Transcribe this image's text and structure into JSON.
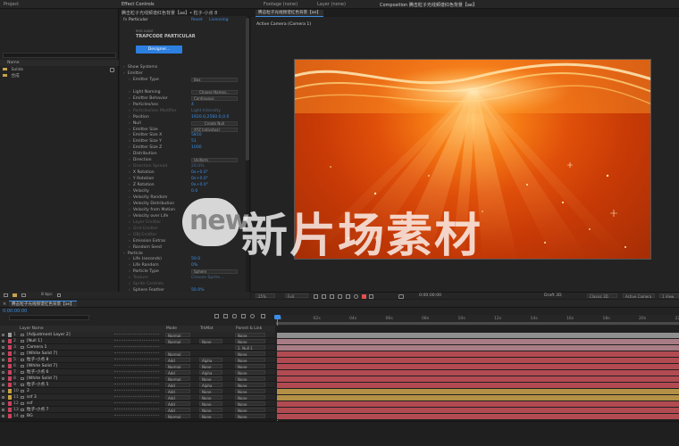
{
  "project_panel": {
    "title": "Project",
    "col_name": "Name",
    "items": [
      {
        "label": "Solids"
      },
      {
        "label": "合成"
      }
    ]
  },
  "effect_controls": {
    "tab": "Effect Controls",
    "layer": "腾击粒子光线频谱红色背景【ae】• 粒子-小点 8",
    "effect_name": "Particular",
    "reset": "Reset",
    "licensing": "Licensing",
    "brand_top": "RED GIANT",
    "brand_main": "TRAPCODE PARTICULAR",
    "designer_button": "Designer...",
    "props": [
      {
        "label": "Show Systems",
        "value": "",
        "indent": 0
      },
      {
        "label": "Emitter",
        "value": "",
        "indent": 0
      },
      {
        "label": "Emitter Type",
        "value": "Box",
        "indent": 1,
        "kind": "drop"
      },
      {
        "label": "",
        "value": "",
        "indent": 1
      },
      {
        "label": "Light Naming",
        "value": "Choose Names...",
        "indent": 1,
        "kind": "btn"
      },
      {
        "label": "Emitter Behavior",
        "value": "Continuous",
        "indent": 1,
        "kind": "drop"
      },
      {
        "label": "Particles/sec",
        "value": "4",
        "indent": 1
      },
      {
        "label": "Particles/sec Modifier",
        "value": "Light Intensity",
        "indent": 1,
        "dim": true
      },
      {
        "label": "Position",
        "value": "1920.0,2560.0,0.0",
        "indent": 1
      },
      {
        "label": "Null",
        "value": "Create Null",
        "indent": 1,
        "kind": "btn"
      },
      {
        "label": "Emitter Size",
        "value": "XYZ Individual",
        "indent": 1,
        "kind": "drop"
      },
      {
        "label": "Emitter Size X",
        "value": "5810",
        "indent": 1
      },
      {
        "label": "Emitter Size Y",
        "value": "51",
        "indent": 1
      },
      {
        "label": "Emitter Size Z",
        "value": "1000",
        "indent": 1
      },
      {
        "label": "Distribution",
        "value": "",
        "indent": 1
      },
      {
        "label": "Direction",
        "value": "Uniform",
        "indent": 1,
        "kind": "drop"
      },
      {
        "label": "Direction Spread",
        "value": "20.0%",
        "indent": 1,
        "dim": true
      },
      {
        "label": "X Rotation",
        "value": "0x+0.0°",
        "indent": 1
      },
      {
        "label": "Y Rotation",
        "value": "0x+0.0°",
        "indent": 1
      },
      {
        "label": "Z Rotation",
        "value": "0x+0.0°",
        "indent": 1
      },
      {
        "label": "Velocity",
        "value": "0.0",
        "indent": 1
      },
      {
        "label": "Velocity Random",
        "value": "",
        "indent": 1
      },
      {
        "label": "Velocity Distribution",
        "value": "",
        "indent": 1
      },
      {
        "label": "Velocity from Motion",
        "value": "",
        "indent": 1
      },
      {
        "label": "Velocity over Life",
        "value": "",
        "indent": 1
      },
      {
        "label": "Layer Emitter",
        "value": "",
        "indent": 1,
        "dim": true
      },
      {
        "label": "Grid Emitter",
        "value": "",
        "indent": 1,
        "dim": true
      },
      {
        "label": "OBJ Emitter",
        "value": "",
        "indent": 1,
        "dim": true
      },
      {
        "label": "Emission Extras",
        "value": "",
        "indent": 1
      },
      {
        "label": "Random Seed",
        "value": "",
        "indent": 1
      },
      {
        "label": "Particle",
        "value": "",
        "indent": 0
      },
      {
        "label": "Life (seconds)",
        "value": "50.0",
        "indent": 1
      },
      {
        "label": "Life Random",
        "value": "0%",
        "indent": 1
      },
      {
        "label": "Particle Type",
        "value": "Sphere",
        "indent": 1,
        "kind": "drop"
      },
      {
        "label": "Texture",
        "value": "Choose Sprite...",
        "indent": 1,
        "dim": true
      },
      {
        "label": "Sprite Controls",
        "value": "",
        "indent": 1,
        "dim": true
      },
      {
        "label": "Sphere Feather",
        "value": "50.0%",
        "indent": 1
      },
      {
        "label": "Particle Physics",
        "value": "",
        "indent": 1
      }
    ]
  },
  "footage_tabs": [
    "Footage (none)",
    "Layer (none)"
  ],
  "comp_panel": {
    "tab": "Composition",
    "comp_name": "腾击粒子光线频谱红色背景【ae】",
    "active_camera": "Active Camera (Camera 1)",
    "sub_tab": "腾击粒子光线频谱红色背景【ae】",
    "zoom": "25%",
    "quality": "Full",
    "timecode": "0:00:00:00",
    "renderer": "Draft 3D",
    "renderer_mode": "Classic 3D",
    "view": "Active Camera",
    "views": "1 View"
  },
  "watermark": {
    "logo": "new",
    "text": "新片场素材"
  },
  "timeline": {
    "tab": "腾击粒子光线频谱红色背景【ae】",
    "timecode": "0:00:00:00",
    "bpc": "8 bpc",
    "headers": {
      "layer_name": "Layer Name",
      "mode": "Mode",
      "trkmat": "TrkMat",
      "parent": "Parent & Link"
    },
    "ruler": [
      "0s",
      "02s",
      "04s",
      "06s",
      "08s",
      "10s",
      "12s",
      "14s",
      "16s",
      "18s",
      "20s",
      "22s"
    ],
    "layers": [
      {
        "num": "1",
        "name": "[Adjustment Layer 2]",
        "mode": "Normal",
        "trkmat": "",
        "parent": "None",
        "color": "#9a9a9a",
        "bar": "#8f8f8f"
      },
      {
        "num": "2",
        "name": "[Null 1]",
        "mode": "Normal",
        "trkmat": "None",
        "parent": "None",
        "color": "#c7435e",
        "bar": "#a87c84"
      },
      {
        "num": "3",
        "name": "Camera 1",
        "mode": "",
        "trkmat": "",
        "parent": "2. Null 1",
        "color": "#c7435e",
        "bar": "#a87c84"
      },
      {
        "num": "4",
        "name": "[White Solid 7]",
        "mode": "Normal",
        "trkmat": "",
        "parent": "None",
        "color": "#c7435e",
        "bar": "#b24a52"
      },
      {
        "num": "5",
        "name": "粒子-小点 8",
        "mode": "Add",
        "trkmat": "Alpha",
        "parent": "None",
        "color": "#c7435e",
        "bar": "#b24a52"
      },
      {
        "num": "6",
        "name": "[White Solid 7]",
        "mode": "Normal",
        "trkmat": "None",
        "parent": "None",
        "color": "#c7435e",
        "bar": "#b24a52"
      },
      {
        "num": "7",
        "name": "粒子-小点 6",
        "mode": "Add",
        "trkmat": "Alpha",
        "parent": "None",
        "color": "#c7435e",
        "bar": "#b24a52"
      },
      {
        "num": "8",
        "name": "[White Solid 7]",
        "mode": "Normal",
        "trkmat": "None",
        "parent": "None",
        "color": "#c7435e",
        "bar": "#b24a52"
      },
      {
        "num": "9",
        "name": "粒子-小点 5",
        "mode": "Add",
        "trkmat": "Alpha",
        "parent": "None",
        "color": "#c7435e",
        "bar": "#b24a52"
      },
      {
        "num": "10",
        "name": "2",
        "mode": "Add",
        "trkmat": "None",
        "parent": "None",
        "color": "#c8a042",
        "bar": "#b39045"
      },
      {
        "num": "11",
        "name": "ssf 3",
        "mode": "Add",
        "trkmat": "None",
        "parent": "None",
        "color": "#c8a042",
        "bar": "#b39045"
      },
      {
        "num": "12",
        "name": "ssf",
        "mode": "Add",
        "trkmat": "None",
        "parent": "None",
        "color": "#c7435e",
        "bar": "#b24a52"
      },
      {
        "num": "13",
        "name": "粒子-小点 7",
        "mode": "Add",
        "trkmat": "None",
        "parent": "None",
        "color": "#c7435e",
        "bar": "#b24a52"
      },
      {
        "num": "14",
        "name": "BG",
        "mode": "Normal",
        "trkmat": "None",
        "parent": "None",
        "color": "#c7435e",
        "bar": "#b24a52"
      }
    ]
  }
}
